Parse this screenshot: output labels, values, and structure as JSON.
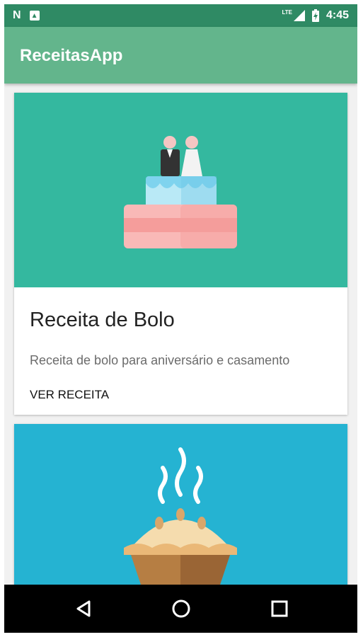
{
  "status_bar": {
    "time": "4:45",
    "network": "LTE",
    "icons": [
      "n-notification-icon",
      "notification-icon",
      "lte-signal-icon",
      "battery-charging-icon"
    ]
  },
  "app_bar": {
    "title": "ReceitasApp"
  },
  "cards": [
    {
      "image": "wedding-cake-icon",
      "title": "Receita de Bolo",
      "description": "Receita de bolo para aniversário e casamento",
      "action": "VER RECEITA",
      "image_bg": "#34b89f"
    },
    {
      "image": "pie-icon",
      "image_bg": "#25b3d2"
    }
  ],
  "nav_bar": {
    "buttons": [
      "back-icon",
      "home-icon",
      "recents-icon"
    ]
  },
  "colors": {
    "status_bar": "#2f8a64",
    "app_bar": "#63b58c"
  }
}
